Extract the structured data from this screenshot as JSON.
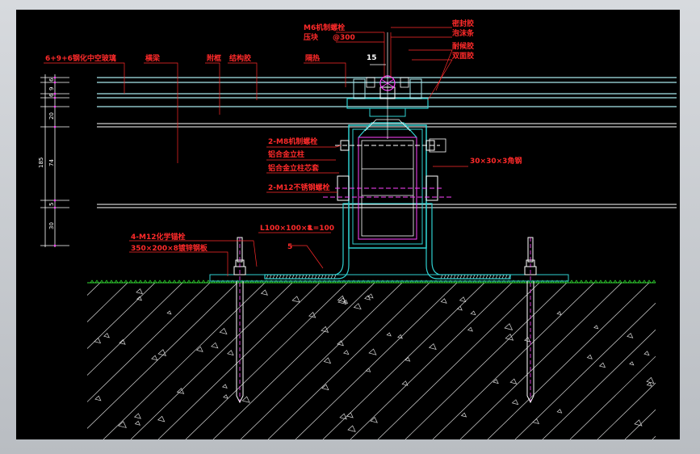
{
  "colors": {
    "background": "#000000",
    "label": "#ff2a2a",
    "glass": "#a8e8ec",
    "aluminum": "#2fd0d0",
    "steel": "#ffffff",
    "ground": "#33dd33",
    "hatch": "#d8d8d8",
    "sealant": "#ff44ff"
  },
  "labels": {
    "glass_spec": "6+9+6钢化中空玻璃",
    "transom": "横梁",
    "sub_frame": "附框",
    "structural_adhesive": "结构胶",
    "bolt_top": "M6机制螺栓",
    "pressure_block": "压块",
    "spacing": "@300",
    "insulation": "隔热",
    "sealant": "密封胶",
    "foam_rod": "泡沫条",
    "weather_sealant": "耐候胶",
    "two_sided_tape": "双面胶",
    "mullion_bolts": "2-M8机制螺栓",
    "alu_mullion": "铝合金立柱",
    "alu_mullion_core": "铝合金立柱芯套",
    "m12_bolts": "2-M12不锈钢螺栓",
    "angle_steel": "L100×100×8",
    "angle_length": "L=100",
    "weld": "5",
    "chem_anchors": "4-M12化学锚栓",
    "embed_plate": "350×200×8镀锌钢板",
    "square_tube": "30×30×3角钢",
    "offset_15": "15"
  },
  "dimensions": {
    "left_values": [
      "6",
      "9",
      "6",
      "20",
      "74",
      "5",
      "30",
      "185"
    ]
  }
}
